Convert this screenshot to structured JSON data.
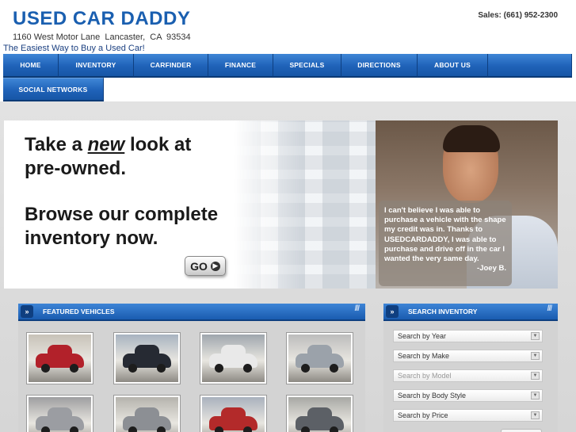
{
  "header": {
    "title": "USED CAR DADDY",
    "address": "1160 West Motor Lane  Lancaster,  CA  93534",
    "tagline": "The Easiest Way to Buy a Used Car!",
    "sales": "Sales: (661) 952-2300"
  },
  "nav": {
    "row1": [
      "HOME",
      "INVENTORY",
      "CARFINDER",
      "FINANCE",
      "SPECIALS",
      "DIRECTIONS",
      "ABOUT US"
    ],
    "row2": [
      "SOCIAL NETWORKS"
    ]
  },
  "banner": {
    "line1_pre": "Take a ",
    "line1_em": "new",
    "line1_post": " look at",
    "line2": "pre-owned.",
    "line3": "Browse our complete",
    "line4": "inventory now.",
    "go_label": "GO",
    "quote": "I can't believe I was able to purchase a vehicle with the shape my credit was in. Thanks to USEDCARDADDY, I was able to purchase and drive off in the car I wanted the very same day.",
    "quote_author": "-Joey B."
  },
  "featured": {
    "title": "FEATURED VEHICLES",
    "icon": "double-chevron-right-icon",
    "vehicles": [
      {
        "color": "#b2212a",
        "bg": "#c7c2b8"
      },
      {
        "color": "#262a33",
        "bg": "#a8b3c0"
      },
      {
        "color": "#e9e9e9",
        "bg": "#9fa6ad"
      },
      {
        "color": "#9ba2aa",
        "bg": "#bcbcbc"
      },
      {
        "color": "#9b9da2",
        "bg": "#9e9ea0"
      },
      {
        "color": "#8c8f94",
        "bg": "#b5b3ad"
      },
      {
        "color": "#b32a2a",
        "bg": "#a9b1bd"
      },
      {
        "color": "#5c6066",
        "bg": "#a7a8a4"
      }
    ]
  },
  "search": {
    "title": "SEARCH INVENTORY",
    "icon": "double-chevron-right-icon",
    "fields": [
      {
        "label": "Search by Year",
        "disabled": false
      },
      {
        "label": "Search by Make",
        "disabled": false
      },
      {
        "label": "Search by Model",
        "disabled": true
      },
      {
        "label": "Search by Body Style",
        "disabled": false
      },
      {
        "label": "Search by Price",
        "disabled": false
      }
    ]
  },
  "colors": {
    "brand": "#1a5fb0",
    "nav": "#1f62b8",
    "content_bg": "#d6d6d6"
  }
}
